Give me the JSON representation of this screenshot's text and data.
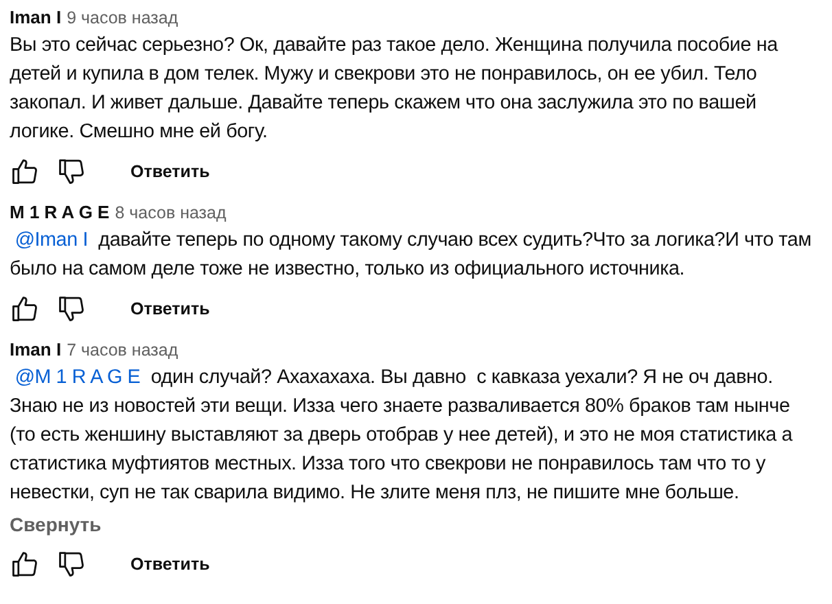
{
  "comments": [
    {
      "author": "Iman I",
      "time": "9 часов назад",
      "text": "Вы это сейчас серьезно? Ок, давайте раз такое дело. Женщина получила пособие на детей и купила в дом телек. Мужу и свекрови это не понравилось, он ее убил. Тело закопал. И живет дальше. Давайте теперь скажем что она заслужила это по вашей логике. Смешно мне ей богу.",
      "reply_label": "Ответить"
    },
    {
      "author": "M 1 R A G E",
      "time": "8 часов назад",
      "mention": "@Iman I",
      "text": "давайте теперь по одному такому случаю всех судить?Что за логика?И что там было на самом деле тоже не известно, только из официального источника.",
      "reply_label": "Ответить"
    },
    {
      "author": "Iman I",
      "time": "7 часов назад",
      "mention": "@M 1 R A G E",
      "text": "один случай? Ахахахаха. Вы давно  с кавказа уехали? Я не оч давно. Знаю не из новостей эти вещи. Изза чего знаете разваливается 80% браков там нынче (то есть женшину выставляют за дверь отобрав у нее детей), и это не моя статистика а статистика муфтиятов местных. Изза того что свекрови не понравилось там что то у невестки, суп не так сварила видимо. Не злите меня плз, не пишите мне больше.",
      "collapse_label": "Свернуть",
      "reply_label": "Ответить"
    }
  ]
}
